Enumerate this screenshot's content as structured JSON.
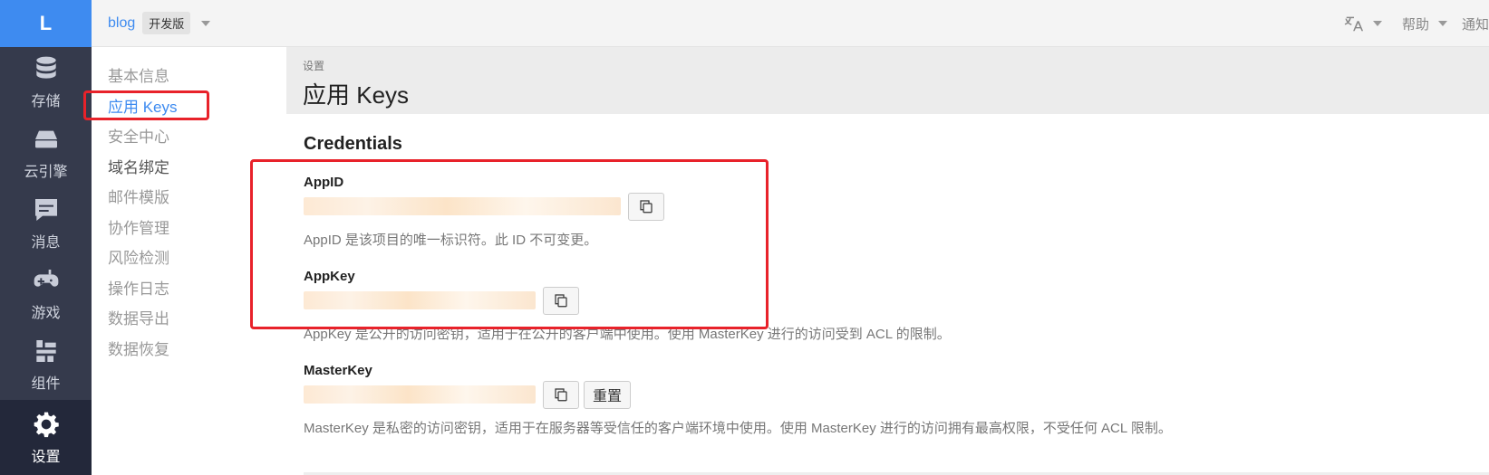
{
  "rail": {
    "logo": "L",
    "items": [
      {
        "label": "存储",
        "icon": "database-icon"
      },
      {
        "label": "云引擎",
        "icon": "server-icon"
      },
      {
        "label": "消息",
        "icon": "message-icon"
      },
      {
        "label": "游戏",
        "icon": "gamepad-icon"
      },
      {
        "label": "组件",
        "icon": "components-icon"
      },
      {
        "label": "设置",
        "icon": "gear-icon"
      }
    ]
  },
  "topbar": {
    "app_name": "blog",
    "env_badge": "开发版",
    "help_label": "帮助",
    "notify_label": "通知"
  },
  "subnav": {
    "items": [
      "基本信息",
      "应用 Keys",
      "安全中心",
      "域名绑定",
      "邮件模版",
      "协作管理",
      "风险检测",
      "操作日志",
      "数据导出",
      "数据恢复"
    ],
    "active": "应用 Keys"
  },
  "header": {
    "breadcrumb": "设置",
    "title": "应用 Keys"
  },
  "credentials": {
    "section_title": "Credentials",
    "appid": {
      "label": "AppID",
      "help": "AppID 是该项目的唯一标识符。此 ID 不可变更。"
    },
    "appkey": {
      "label": "AppKey",
      "help": "AppKey 是公开的访问密钥，适用于在公开的客户端中使用。使用 MasterKey 进行的访问受到 ACL 的限制。"
    },
    "masterkey": {
      "label": "MasterKey",
      "reset_label": "重置",
      "help": "MasterKey 是私密的访问密钥，适用于在服务器等受信任的客户端环境中使用。使用 MasterKey 进行的访问拥有最高权限，不受任何 ACL 限制。"
    }
  },
  "colors": {
    "accent": "#3e8bf0",
    "rail_bg": "#353a4c",
    "highlight": "#e8222a"
  }
}
